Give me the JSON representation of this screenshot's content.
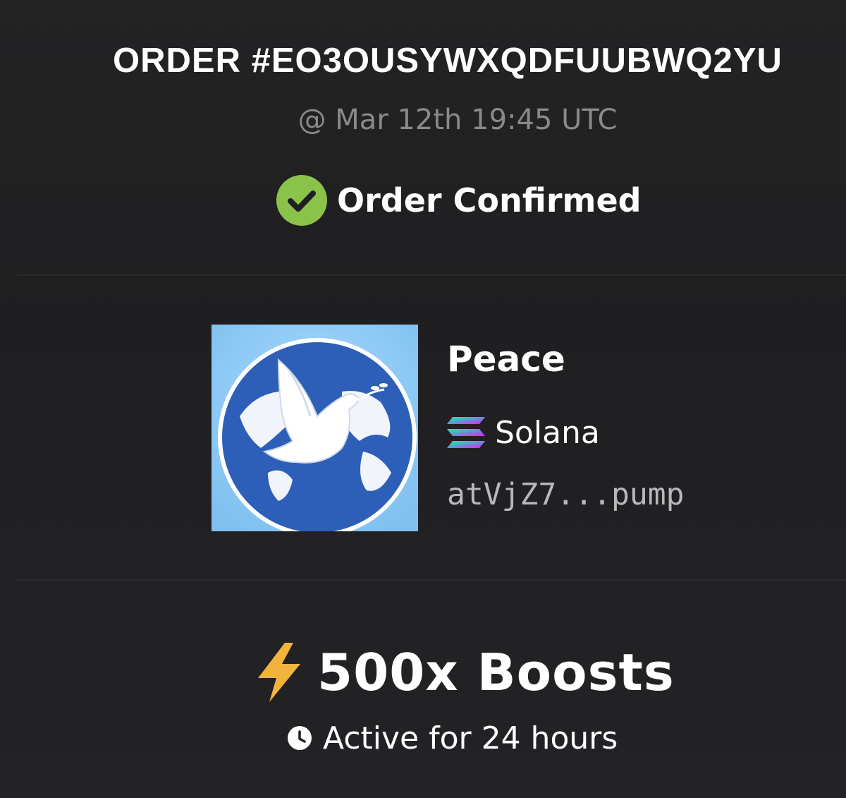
{
  "order": {
    "title": "ORDER #EO3OUSYWXQDFUUBWQ2YU",
    "timestamp": "@ Mar 12th 19:45 UTC",
    "status": "Order Confirmed",
    "status_icon": "check-circle-icon",
    "status_color": "#8bc34a"
  },
  "token": {
    "name": "Peace",
    "image_icon": "dove-globe-logo",
    "chain": "Solana",
    "chain_icon": "solana-icon",
    "address": "atVjZ7...pump"
  },
  "boost": {
    "label": "500x Boosts",
    "icon": "lightning-bolt-icon",
    "icon_color": "#f2b33d",
    "duration": "Active for 24 hours",
    "duration_icon": "clock-icon"
  },
  "colors": {
    "background": "#1f1f21",
    "muted_text": "#8a8a8c",
    "address_text": "#b8b8ba"
  }
}
